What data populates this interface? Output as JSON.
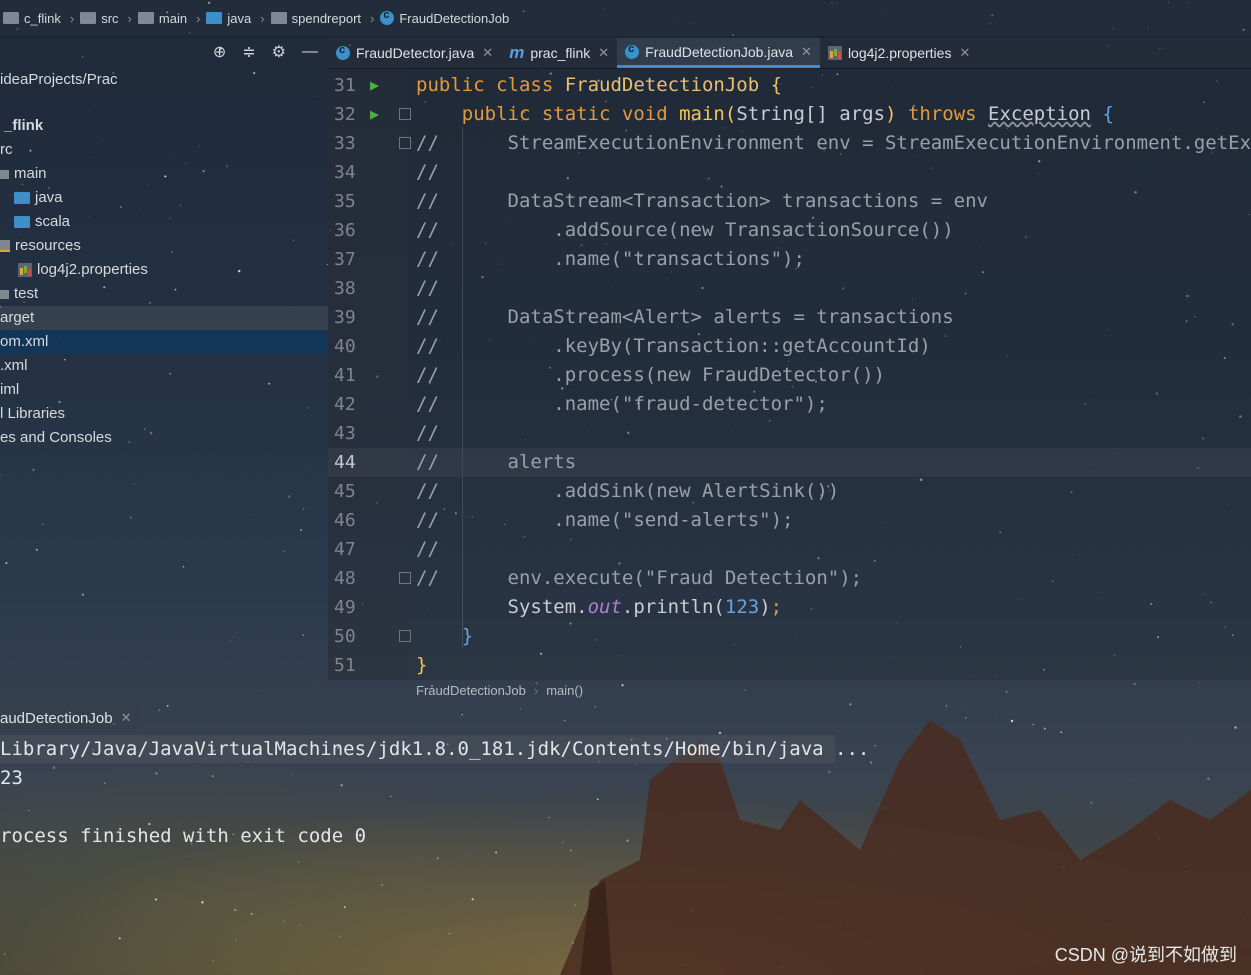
{
  "breadcrumb": [
    "c_flink",
    "src",
    "main",
    "java",
    "spendreport",
    "FraudDetectionJob"
  ],
  "tabs": [
    {
      "label": "FraudDetector.java",
      "icon": "class-icon",
      "active": false
    },
    {
      "label": "prac_flink",
      "icon": "maven-m-icon",
      "active": false
    },
    {
      "label": "FraudDetectionJob.java",
      "icon": "class-icon",
      "active": true
    },
    {
      "label": "log4j2.properties",
      "icon": "properties-icon",
      "active": false
    }
  ],
  "tree": {
    "root_path": "ideaProjects/Prac",
    "items": [
      {
        "label": "_flink",
        "bold": true
      },
      {
        "label": "rc"
      },
      {
        "label": "main"
      },
      {
        "label": "java"
      },
      {
        "label": "scala"
      },
      {
        "label": "resources"
      },
      {
        "label": "log4j2.properties"
      },
      {
        "label": "test"
      },
      {
        "label": "arget"
      },
      {
        "label": "om.xml"
      },
      {
        "label": ".xml"
      },
      {
        "label": "iml"
      },
      {
        "label": "l Libraries"
      },
      {
        "label": "es and Consoles"
      }
    ]
  },
  "editor": {
    "lines": [
      {
        "num": "31",
        "segments": [
          [
            "kw",
            "public class "
          ],
          [
            "cls",
            "FraudDetectionJob "
          ],
          [
            "fn",
            "{"
          ]
        ]
      },
      {
        "num": "32",
        "segments": [
          [
            "kw",
            "    public static void "
          ],
          [
            "fn",
            "main"
          ],
          [
            "fn",
            "("
          ],
          [
            "plain",
            "String"
          ],
          [
            "plain",
            "[]"
          ],
          [
            "plain",
            " args"
          ],
          [
            "fn",
            ")"
          ],
          [
            "kw",
            " throws "
          ],
          [
            "under",
            "Exception"
          ],
          [
            "plain",
            " "
          ],
          [
            "num",
            "{"
          ]
        ]
      },
      {
        "num": "33",
        "segments": [
          [
            "cm",
            "//      StreamExecutionEnvironment env = StreamExecutionEnvironment.getExecu"
          ]
        ]
      },
      {
        "num": "34",
        "segments": [
          [
            "cm",
            "//"
          ]
        ]
      },
      {
        "num": "35",
        "segments": [
          [
            "cm",
            "//      DataStream<Transaction> transactions = env"
          ]
        ]
      },
      {
        "num": "36",
        "segments": [
          [
            "cm",
            "//          .addSource(new TransactionSource())"
          ]
        ]
      },
      {
        "num": "37",
        "segments": [
          [
            "cm",
            "//          .name(\"transactions\");"
          ]
        ]
      },
      {
        "num": "38",
        "segments": [
          [
            "cm",
            "//"
          ]
        ]
      },
      {
        "num": "39",
        "segments": [
          [
            "cm",
            "//      DataStream<Alert> alerts = transactions"
          ]
        ]
      },
      {
        "num": "40",
        "segments": [
          [
            "cm",
            "//          .keyBy(Transaction::getAccountId)"
          ]
        ]
      },
      {
        "num": "41",
        "segments": [
          [
            "cm",
            "//          .process(new FraudDetector())"
          ]
        ]
      },
      {
        "num": "42",
        "segments": [
          [
            "cm",
            "//          .name(\"fraud-detector\");"
          ]
        ]
      },
      {
        "num": "43",
        "segments": [
          [
            "cm",
            "//"
          ]
        ]
      },
      {
        "num": "44",
        "segments": [
          [
            "cm",
            "//      alerts"
          ]
        ]
      },
      {
        "num": "45",
        "segments": [
          [
            "cm",
            "//          .addSink(new AlertSink())"
          ]
        ]
      },
      {
        "num": "46",
        "segments": [
          [
            "cm",
            "//          .name(\"send-alerts\");"
          ]
        ]
      },
      {
        "num": "47",
        "segments": [
          [
            "cm",
            "//"
          ]
        ]
      },
      {
        "num": "48",
        "segments": [
          [
            "cm",
            "//      env.execute(\"Fraud Detection\");"
          ]
        ]
      },
      {
        "num": "49",
        "segments": [
          [
            "plain",
            "        System."
          ],
          [
            "purple",
            "out"
          ],
          [
            "plain",
            ".println("
          ],
          [
            "num",
            "123"
          ],
          [
            "plain",
            ")"
          ],
          [
            "kw",
            ";"
          ]
        ]
      },
      {
        "num": "50",
        "segments": [
          [
            "plain",
            "    "
          ],
          [
            "num",
            "}"
          ]
        ]
      },
      {
        "num": "51",
        "segments": [
          [
            "fn",
            "}"
          ]
        ]
      }
    ],
    "current_line": "44",
    "footer_crumbs": [
      "FraudDetectionJob",
      "main()"
    ]
  },
  "run": {
    "tab_label": "audDetectionJob",
    "console": [
      "Library/Java/JavaVirtualMachines/jdk1.8.0_181.jdk/Contents/Home/bin/java ...",
      "23",
      "",
      "rocess finished with exit code 0"
    ]
  },
  "watermark": "CSDN @说到不如做到"
}
